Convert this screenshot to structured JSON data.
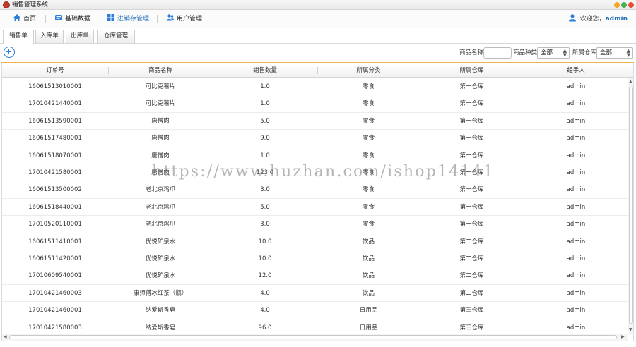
{
  "window": {
    "title": "销售管理系统"
  },
  "menu": {
    "items": [
      {
        "label": "首页",
        "icon": "home-icon"
      },
      {
        "label": "基础数据",
        "icon": "database-icon"
      },
      {
        "label": "进销存管理",
        "icon": "inventory-icon"
      },
      {
        "label": "用户管理",
        "icon": "users-icon"
      }
    ],
    "welcome_prefix": "欢迎您，",
    "username": "admin"
  },
  "tabs": [
    {
      "label": "销售单",
      "active": true
    },
    {
      "label": "入库单",
      "active": false
    },
    {
      "label": "出库单",
      "active": false
    },
    {
      "label": "仓库管理",
      "active": false
    }
  ],
  "filters": {
    "product_name_label": "商品名称",
    "product_name_value": "",
    "category_label": "商品种类",
    "category_value": "全部",
    "warehouse_label": "所属仓库",
    "warehouse_value": "全部"
  },
  "table": {
    "columns": [
      "订单号",
      "商品名称",
      "销售数量",
      "所属分类",
      "所属仓库",
      "经手人"
    ],
    "rows": [
      [
        "16061513010001",
        "可比克薯片",
        "1.0",
        "零食",
        "第一仓库",
        "admin"
      ],
      [
        "17010421440001",
        "可比克薯片",
        "1.0",
        "零食",
        "第一仓库",
        "admin"
      ],
      [
        "16061513590001",
        "唐僧肉",
        "5.0",
        "零食",
        "第一仓库",
        "admin"
      ],
      [
        "16061517480001",
        "唐僧肉",
        "9.0",
        "零食",
        "第一仓库",
        "admin"
      ],
      [
        "16061518070001",
        "唐僧肉",
        "1.0",
        "零食",
        "第一仓库",
        "admin"
      ],
      [
        "17010421580001",
        "唐僧肉",
        "123.0",
        "零食",
        "第一仓库",
        "admin"
      ],
      [
        "16061513500002",
        "老北京鸡爪",
        "3.0",
        "零食",
        "第一仓库",
        "admin"
      ],
      [
        "16061518440001",
        "老北京鸡爪",
        "5.0",
        "零食",
        "第一仓库",
        "admin"
      ],
      [
        "17010520110001",
        "老北京鸡爪",
        "3.0",
        "零食",
        "第一仓库",
        "admin"
      ],
      [
        "16061511410001",
        "优悦矿泉水",
        "10.0",
        "饮品",
        "第二仓库",
        "admin"
      ],
      [
        "16061511420001",
        "优悦矿泉水",
        "10.0",
        "饮品",
        "第二仓库",
        "admin"
      ],
      [
        "17010609540001",
        "优悦矿泉水",
        "12.0",
        "饮品",
        "第二仓库",
        "admin"
      ],
      [
        "17010421460003",
        "康师傅冰红茶（瓶）",
        "4.0",
        "饮品",
        "第二仓库",
        "admin"
      ],
      [
        "17010421460001",
        "纳爱斯香皂",
        "4.0",
        "日用品",
        "第三仓库",
        "admin"
      ],
      [
        "17010421580003",
        "纳爱斯香皂",
        "96.0",
        "日用品",
        "第三仓库",
        "admin"
      ]
    ]
  },
  "watermark": "https://www.huzhan.com/ishop14141",
  "colors": {
    "accent": "#2b7fd8",
    "header_rule": "#e9b24c",
    "username": "#1f6fb8"
  }
}
